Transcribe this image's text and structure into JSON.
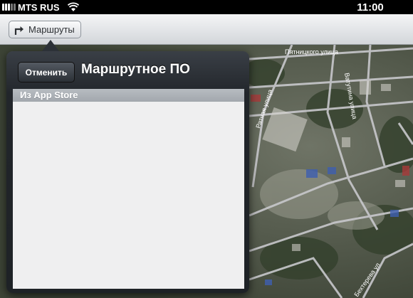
{
  "status_bar": {
    "carrier": "MTS RUS",
    "time": "11:00"
  },
  "toolbar": {
    "routes_label": "Маршруты",
    "routes_icon": "turn-right-arrow-icon"
  },
  "map": {
    "type": "satellite",
    "street_labels": [
      "Пятницкого улица",
      "Ратная улица",
      "Ватутина улица",
      "Бехтерева ул"
    ]
  },
  "popover": {
    "cancel_label": "Отменить",
    "title": "Маршрутное ПО",
    "section_header": "Из App Store"
  }
}
